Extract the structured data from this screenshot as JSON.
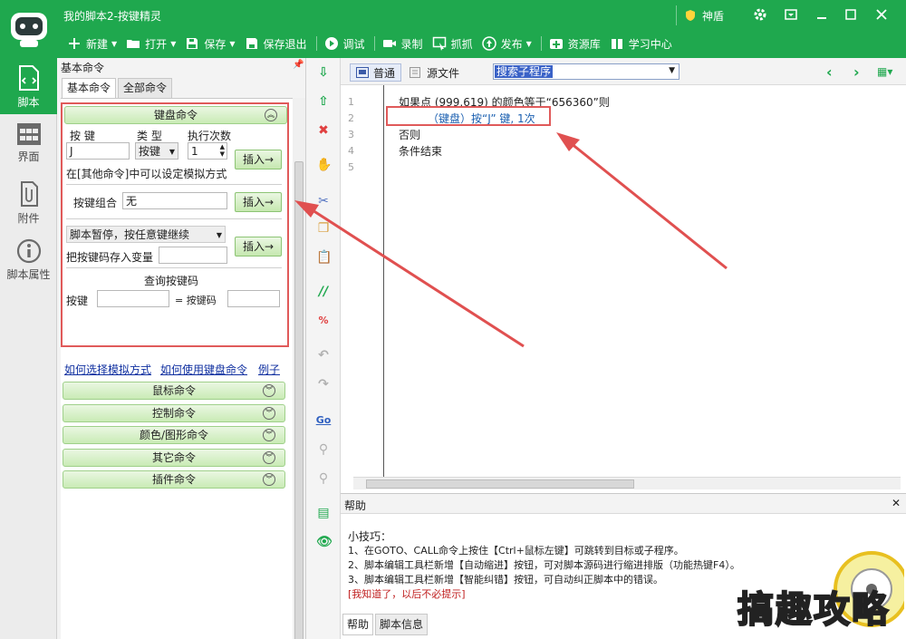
{
  "app": {
    "title": "我的脚本2-按键精灵",
    "shield_label": "神盾"
  },
  "toolbar": {
    "items": [
      {
        "label": "新建",
        "icon": "plus-icon",
        "dropdown": true
      },
      {
        "label": "打开",
        "icon": "folder-icon",
        "dropdown": true
      },
      {
        "label": "保存",
        "icon": "floppy-icon",
        "dropdown": true
      },
      {
        "label": "保存退出",
        "icon": "save-exit-icon",
        "dropdown": false
      },
      {
        "label": "调试",
        "icon": "play-icon",
        "dropdown": false
      },
      {
        "label": "录制",
        "icon": "camera-icon",
        "dropdown": false
      },
      {
        "label": "抓抓",
        "icon": "capture-icon",
        "dropdown": false
      },
      {
        "label": "发布",
        "icon": "publish-icon",
        "dropdown": true
      },
      {
        "label": "资源库",
        "icon": "resource-icon",
        "dropdown": false
      },
      {
        "label": "学习中心",
        "icon": "book-icon",
        "dropdown": false
      }
    ]
  },
  "leftnav": {
    "items": [
      {
        "label": "脚本",
        "icon": "script-file-icon",
        "active": true
      },
      {
        "label": "界面",
        "icon": "grid-icon",
        "active": false
      },
      {
        "label": "附件",
        "icon": "attachment-icon",
        "active": false
      },
      {
        "label": "脚本属性",
        "icon": "info-icon",
        "active": false
      }
    ]
  },
  "panel": {
    "title": "基本命令",
    "pin": "ᵖ",
    "tabs": [
      "基本命令",
      "全部命令"
    ],
    "keyboard_group": "键盘命令",
    "key_label": "按 键",
    "type_label": "类 型",
    "count_label": "执行次数",
    "key_value": "J",
    "type_value": "按键",
    "count_value": "1",
    "insert_label": "插入→",
    "note_other": "在[其他命令]中可以设定模拟方式",
    "combo_label": "按键组合",
    "combo_value": "无",
    "pause_select": "脚本暂停，按任意键继续",
    "store_label": "把按键码存入变量",
    "query_title": "查询按键码",
    "query_key_label": "按键",
    "query_code_label": "= 按键码",
    "links": [
      "如何选择模拟方式",
      "如何使用键盘命令",
      "例子"
    ],
    "groups": [
      "鼠标命令",
      "控制命令",
      "颜色/图形命令",
      "其它命令",
      "插件命令"
    ]
  },
  "editor": {
    "tab_normal": "普通",
    "tab_source": "源文件",
    "search_value": "搜索子程序",
    "line_numbers": [
      "1",
      "2",
      "3",
      "4",
      "5"
    ],
    "lines": [
      "如果点 (999,619) 的颜色等于“656360”则",
      "（键盘）按“J” 键, 1次",
      "否则",
      "条件结束",
      ""
    ]
  },
  "help": {
    "title": "帮助",
    "tip_title": "小技巧：",
    "tips": [
      "1、在GOTO、CALL命令上按住【Ctrl+鼠标左键】可跳转到目标或子程序。",
      "2、脚本编辑工具栏新增【自动缩进】按钮，可对脚本源码进行缩进排版（功能热键F4）。",
      "3、脚本编辑工具栏新增【智能纠错】按钮，可自动纠正脚本中的错误。"
    ],
    "dismiss": "[我知道了，以后不必提示]",
    "tabs": [
      "帮助",
      "脚本信息"
    ]
  },
  "watermark": {
    "text": "搞趣攻略"
  },
  "colors": {
    "brand_green": "#1fa84e",
    "highlight_red": "#e05a5a"
  }
}
